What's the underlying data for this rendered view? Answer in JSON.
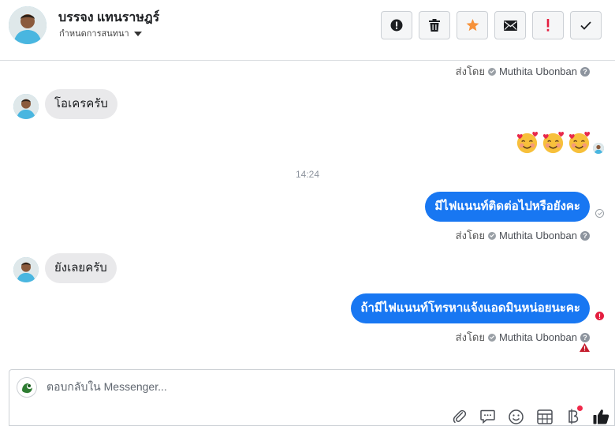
{
  "header": {
    "contact_name": "บรรจง แทนราษฎร์",
    "assign_label": "กำหนดการสนทนา",
    "actions": [
      {
        "name": "mark-spam-button",
        "icon": "alert-circle-icon"
      },
      {
        "name": "delete-button",
        "icon": "trash-icon"
      },
      {
        "name": "star-button",
        "icon": "star-icon"
      },
      {
        "name": "mark-unread-button",
        "icon": "envelope-icon"
      },
      {
        "name": "follow-up-button",
        "icon": "exclamation-icon"
      },
      {
        "name": "mark-done-button",
        "icon": "check-icon"
      }
    ]
  },
  "messages": {
    "sent_by_label": "ส่งโดย",
    "sender_name": "Muthita Ubonban",
    "in_1": "โอเครครับ",
    "time_divider": "14:24",
    "out_1": "มีไฟแนนท์ติดต่อไปหรือยังคะ",
    "in_2": "ยังเลยครับ",
    "out_2": "ถ้ามีไฟแนนท์โทรหาแจ้งแอดมินหน่อยนะคะ",
    "emoji_count": 3,
    "accent_color": "#1877f2",
    "error_color": "#e41e3f"
  },
  "composer": {
    "placeholder": "ตอบกลับใน Messenger...",
    "tools": [
      "paperclip-icon",
      "speech-bubble-icon",
      "smiley-icon",
      "table-icon",
      "baht-icon",
      "thumbs-up-icon"
    ]
  }
}
